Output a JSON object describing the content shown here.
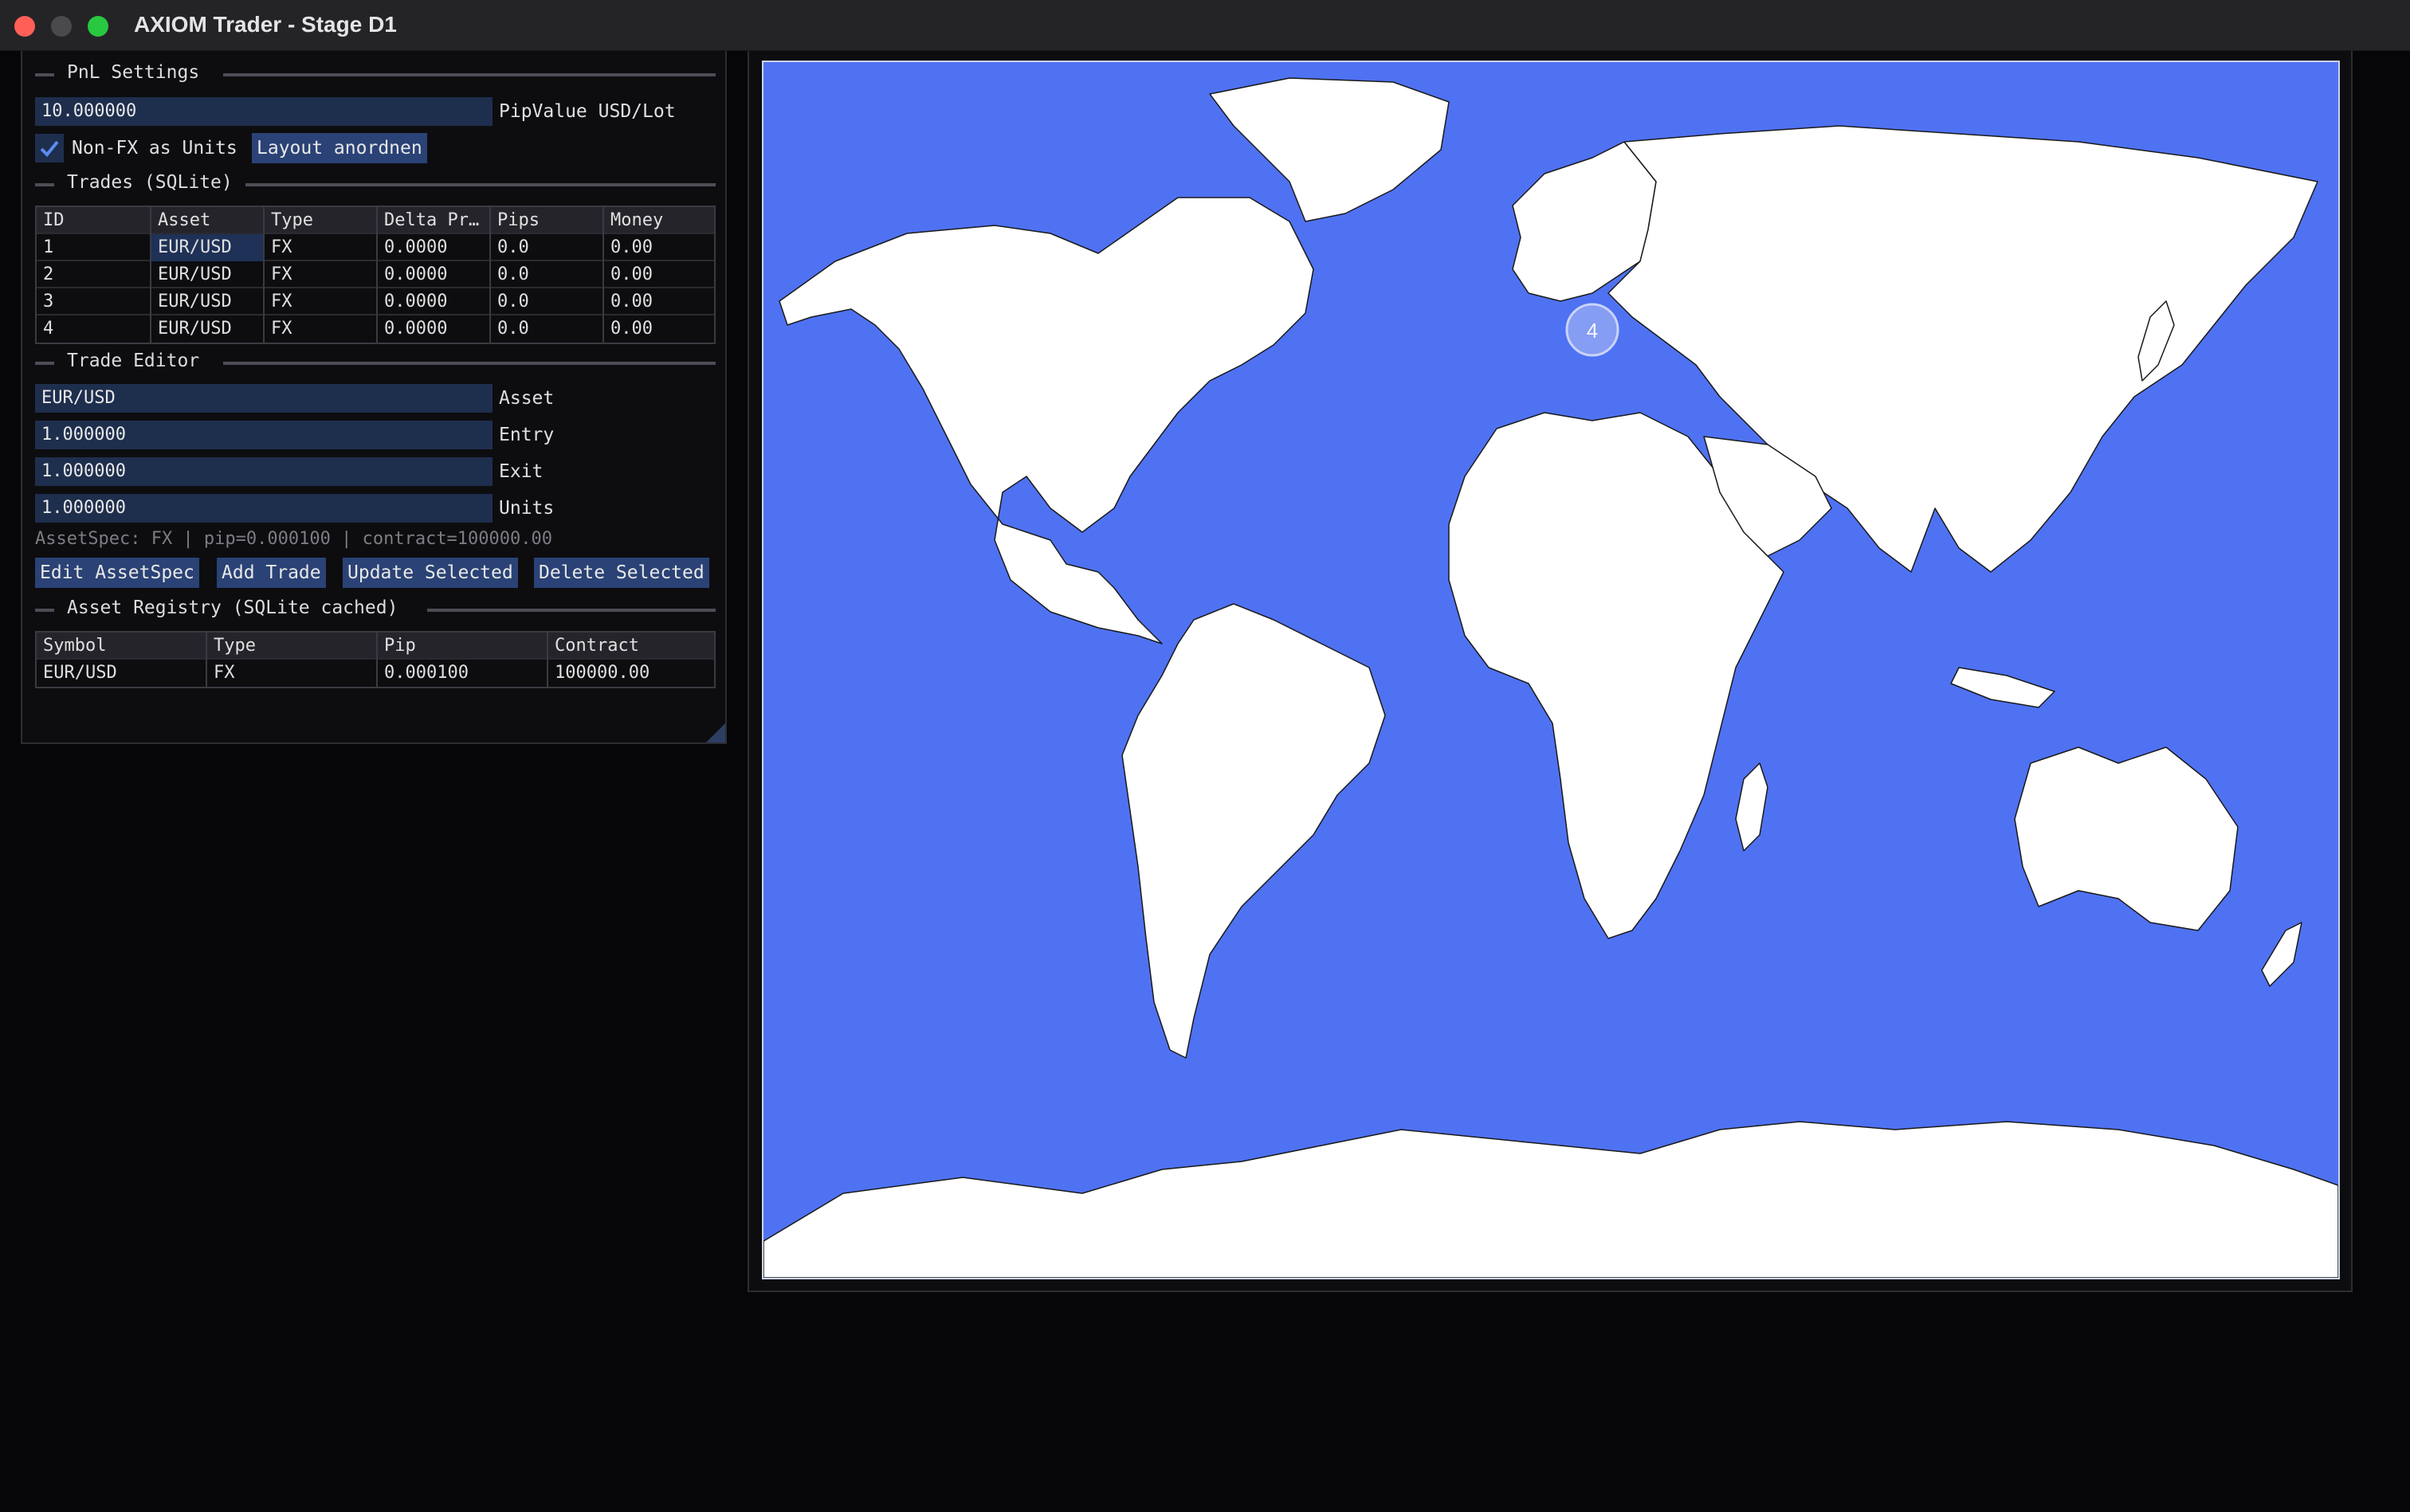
{
  "window": {
    "title": "AXIOM Trader - Stage D1"
  },
  "pnl_settings": {
    "heading": "PnL Settings",
    "pip_value": "10.000000",
    "pip_value_label": "PipValue USD/Lot",
    "nonfx_checked": true,
    "nonfx_label": "Non-FX as Units",
    "layout_button": "Layout anordnen"
  },
  "trades": {
    "heading": "Trades (SQLite)",
    "columns": [
      "ID",
      "Asset",
      "Type",
      "Delta Pr…",
      "Pips",
      "Money"
    ],
    "rows": [
      [
        "1",
        "EUR/USD",
        "FX",
        "0.0000",
        "0.0",
        "0.00"
      ],
      [
        "2",
        "EUR/USD",
        "FX",
        "0.0000",
        "0.0",
        "0.00"
      ],
      [
        "3",
        "EUR/USD",
        "FX",
        "0.0000",
        "0.0",
        "0.00"
      ],
      [
        "4",
        "EUR/USD",
        "FX",
        "0.0000",
        "0.0",
        "0.00"
      ]
    ],
    "selected": {
      "row": 0,
      "column": 1
    }
  },
  "trade_editor": {
    "heading": "Trade Editor",
    "asset": "EUR/USD",
    "asset_label": "Asset",
    "entry": "1.000000",
    "entry_label": "Entry",
    "exit": "1.000000",
    "exit_label": "Exit",
    "units": "1.000000",
    "units_label": "Units",
    "spec_line": "AssetSpec: FX | pip=0.000100 | contract=100000.00",
    "buttons": {
      "edit_spec": "Edit AssetSpec",
      "add_trade": "Add Trade",
      "update": "Update Selected",
      "delete": "Delete Selected"
    }
  },
  "registry": {
    "heading": "Asset Registry (SQLite cached)",
    "columns": [
      "Symbol",
      "Type",
      "Pip",
      "Contract"
    ],
    "rows": [
      [
        "EUR/USD",
        "FX",
        "0.000100",
        "100000.00"
      ]
    ]
  },
  "map": {
    "cluster_count": "4",
    "ocean_color": "#4f72f2",
    "land_color": "#ffffff",
    "cluster_color": "#8ea4f2"
  }
}
